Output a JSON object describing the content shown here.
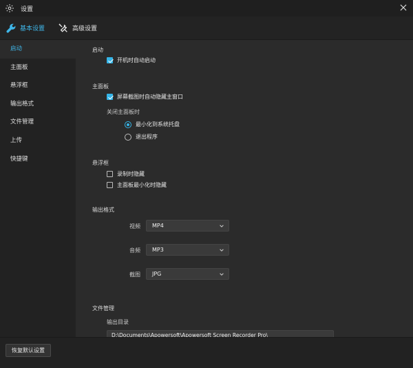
{
  "window": {
    "title": "设置"
  },
  "tabs": [
    {
      "label": "基本设置",
      "active": true,
      "icon": "wrench-icon"
    },
    {
      "label": "高级设置",
      "active": false,
      "icon": "tools-icon"
    }
  ],
  "sidebar": {
    "items": [
      {
        "label": "启动",
        "active": true
      },
      {
        "label": "主面板",
        "active": false
      },
      {
        "label": "悬浮框",
        "active": false
      },
      {
        "label": "输出格式",
        "active": false
      },
      {
        "label": "文件管理",
        "active": false
      },
      {
        "label": "上传",
        "active": false
      },
      {
        "label": "快捷键",
        "active": false
      }
    ]
  },
  "startup": {
    "title": "启动",
    "auto_start": {
      "label": "开机时自动启动",
      "checked": true
    }
  },
  "main_panel": {
    "title": "主面板",
    "hide_on_capture": {
      "label": "屏幕截图时自动隐藏主窗口",
      "checked": true
    },
    "close_label": "关闭主面板时",
    "close_options": [
      {
        "label": "最小化到系统托盘",
        "checked": true
      },
      {
        "label": "退出程序",
        "checked": false
      }
    ]
  },
  "floating": {
    "title": "悬浮框",
    "hide_recording": {
      "label": "录制时隐藏",
      "checked": false
    },
    "hide_minimized": {
      "label": "主面板最小化时隐藏",
      "checked": false
    }
  },
  "output": {
    "title": "输出格式",
    "video": {
      "label": "视频",
      "value": "MP4"
    },
    "audio": {
      "label": "音频",
      "value": "MP3"
    },
    "image": {
      "label": "截图",
      "value": "JPG"
    }
  },
  "files": {
    "title": "文件管理",
    "dir_label": "输出目录",
    "dir_value": "D:\\Documents\\Apowersoft\\Apowersoft Screen Recorder Pro\\"
  },
  "footer": {
    "restore_label": "恢复默认设置"
  },
  "colors": {
    "accent": "#35b5e8",
    "bg": "#2b2b2b",
    "sidebar_bg": "#222222"
  }
}
